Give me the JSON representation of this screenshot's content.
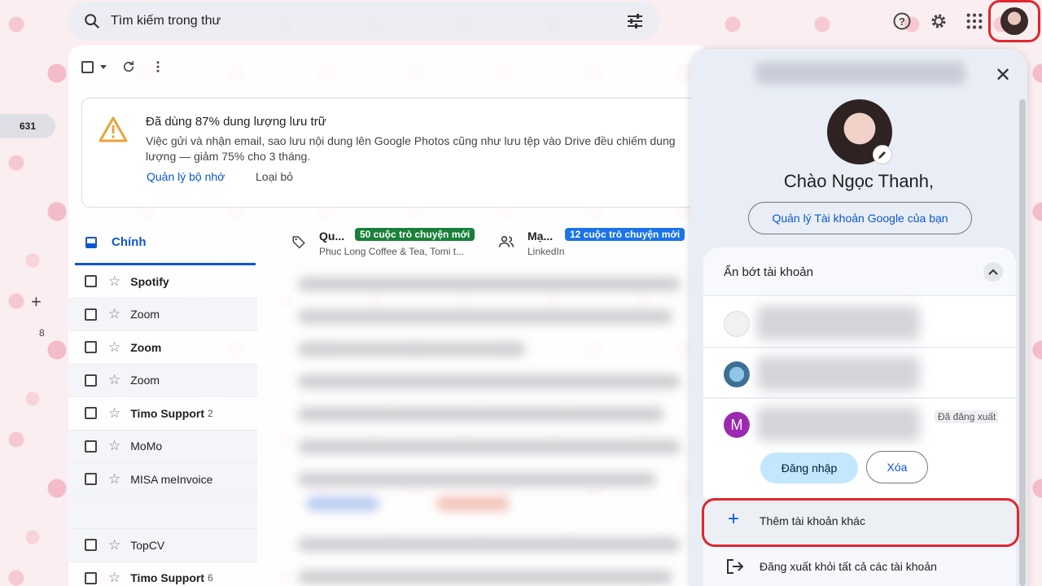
{
  "search": {
    "placeholder": "Tìm kiếm trong thư"
  },
  "rail": {
    "inbox_count": "631",
    "more_count": "8"
  },
  "storage_banner": {
    "title": "Đã dùng 87% dung lượng lưu trữ",
    "description": "Việc gửi và nhận email, sao lưu nội dung lên Google Photos cũng như lưu tệp vào Drive đều chiếm dung lượng — giảm 75% cho 3 tháng.",
    "manage_link": "Quản lý bộ nhớ",
    "dismiss_link": "Loại bỏ"
  },
  "tabs": {
    "primary": "Chính",
    "promotions": {
      "name": "Qu...",
      "badge": "50 cuộc trò chuyện mới",
      "senders": "Phuc Long Coffee & Tea, Tomi t..."
    },
    "social": {
      "name": "Mạ...",
      "badge": "12 cuộc trò chuyện mới",
      "senders": "LinkedIn"
    }
  },
  "emails": [
    {
      "sender": "Spotify",
      "unread": true,
      "count": ""
    },
    {
      "sender": "Zoom",
      "unread": false,
      "count": ""
    },
    {
      "sender": "Zoom",
      "unread": true,
      "count": ""
    },
    {
      "sender": "Zoom",
      "unread": false,
      "count": ""
    },
    {
      "sender": "Timo Support",
      "unread": true,
      "count": "2"
    },
    {
      "sender": "MoMo",
      "unread": false,
      "count": ""
    },
    {
      "sender": "MISA meInvoice",
      "unread": false,
      "count": ""
    },
    {
      "sender": "",
      "unread": false,
      "count": ""
    },
    {
      "sender": "TopCV",
      "unread": false,
      "count": ""
    },
    {
      "sender": "Timo Support",
      "unread": true,
      "count": "6"
    }
  ],
  "account_panel": {
    "greeting": "Chào Ngọc Thanh,",
    "manage_account": "Quản lý Tài khoản Google của bạn",
    "hide_accounts": "Ẩn bớt tài khoản",
    "signed_out_label": "Đã đăng xuất",
    "third_account_initial": "M",
    "sign_in": "Đăng nhập",
    "remove": "Xóa",
    "add_account": "Thêm tài khoản khác",
    "sign_out_all": "Đăng xuất khỏi tất cả các tài khoản"
  },
  "colors": {
    "accent_blue": "#0b57d0",
    "promo_green": "#188038",
    "social_blue": "#1a73e8",
    "highlight_red": "#e0262f",
    "avatar_purple": "#9c27b0"
  }
}
